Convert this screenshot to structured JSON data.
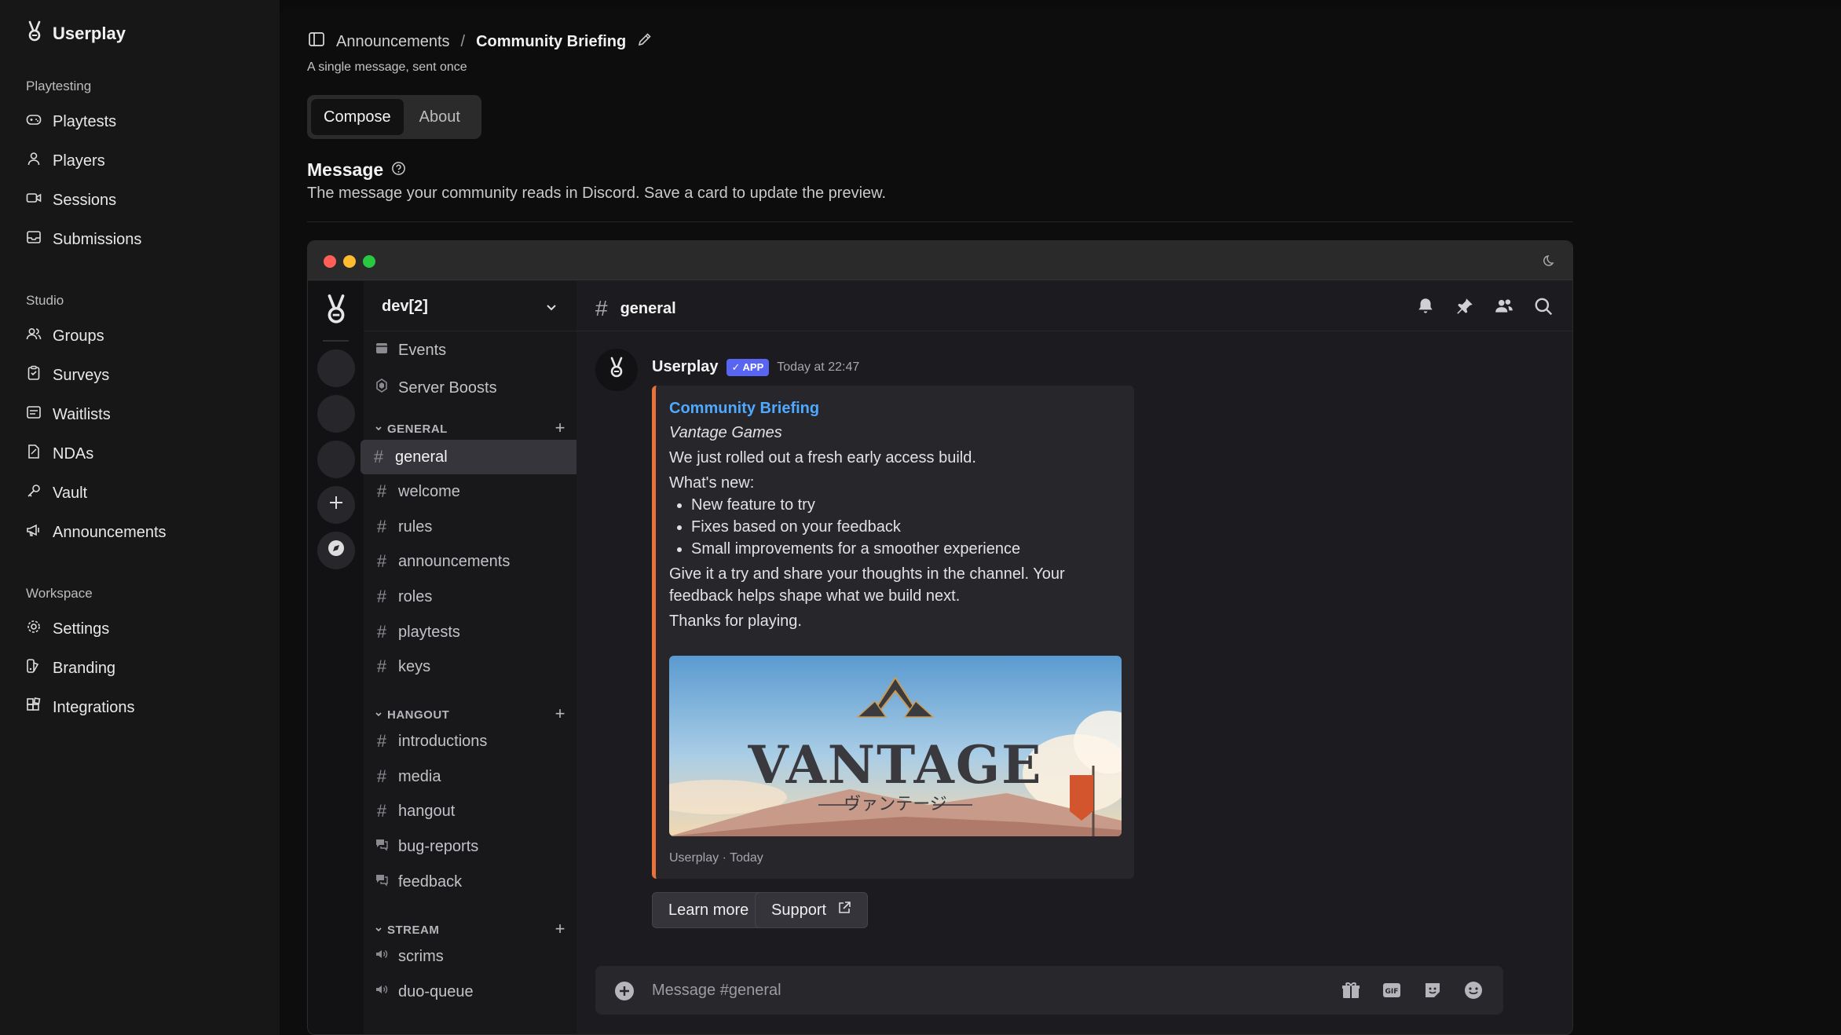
{
  "app": {
    "name": "Userplay"
  },
  "sidebar": {
    "sections": [
      {
        "title": "Playtesting",
        "items": [
          {
            "label": "Playtests",
            "icon": "gamepad-icon"
          },
          {
            "label": "Players",
            "icon": "user-icon"
          },
          {
            "label": "Sessions",
            "icon": "video-icon"
          },
          {
            "label": "Submissions",
            "icon": "inbox-icon"
          }
        ]
      },
      {
        "title": "Studio",
        "items": [
          {
            "label": "Groups",
            "icon": "users-icon"
          },
          {
            "label": "Surveys",
            "icon": "clipboard-icon"
          },
          {
            "label": "Waitlists",
            "icon": "list-icon"
          },
          {
            "label": "NDAs",
            "icon": "document-icon"
          },
          {
            "label": "Vault",
            "icon": "key-icon"
          },
          {
            "label": "Announcements",
            "icon": "megaphone-icon"
          }
        ]
      },
      {
        "title": "Workspace",
        "items": [
          {
            "label": "Settings",
            "icon": "gear-icon"
          },
          {
            "label": "Branding",
            "icon": "palette-icon"
          },
          {
            "label": "Integrations",
            "icon": "blocks-icon"
          }
        ]
      }
    ]
  },
  "header": {
    "breadcrumb_parent": "Announcements",
    "breadcrumb_separator": "/",
    "breadcrumb_current": "Community Briefing",
    "subtitle": "A single message, sent once"
  },
  "tabs": [
    {
      "label": "Compose",
      "active": true
    },
    {
      "label": "About",
      "active": false
    }
  ],
  "message_section": {
    "title": "Message",
    "description": "The message your community reads in Discord. Save a card to update the preview."
  },
  "discord": {
    "server_name": "dev[2]",
    "pre_channels": [
      {
        "label": "Events",
        "icon": "calendar-icon"
      },
      {
        "label": "Server Boosts",
        "icon": "boost-icon"
      }
    ],
    "categories": [
      {
        "name": "GENERAL",
        "channels": [
          {
            "label": "general",
            "type": "text",
            "active": true
          },
          {
            "label": "welcome",
            "type": "text"
          },
          {
            "label": "rules",
            "type": "text"
          },
          {
            "label": "announcements",
            "type": "text"
          },
          {
            "label": "roles",
            "type": "text"
          },
          {
            "label": "playtests",
            "type": "text"
          },
          {
            "label": "keys",
            "type": "text"
          }
        ]
      },
      {
        "name": "HANGOUT",
        "channels": [
          {
            "label": "introductions",
            "type": "text"
          },
          {
            "label": "media",
            "type": "text"
          },
          {
            "label": "hangout",
            "type": "text"
          },
          {
            "label": "bug-reports",
            "type": "forum"
          },
          {
            "label": "feedback",
            "type": "forum"
          }
        ]
      },
      {
        "name": "STREAM",
        "channels": [
          {
            "label": "scrims",
            "type": "voice"
          },
          {
            "label": "duo-queue",
            "type": "voice"
          }
        ]
      }
    ],
    "channel_title": "general",
    "message": {
      "author": "Userplay",
      "badge": "APP",
      "timestamp": "Today at 22:47",
      "embed": {
        "title": "Community Briefing",
        "author": "Vantage Games",
        "intro": "We just rolled out a fresh early access build.",
        "whats_new_label": "What's new:",
        "bullets": [
          "New feature to try",
          "Fixes based on your feedback",
          "Small improvements for a smoother experience"
        ],
        "body": "Give it a try and share your thoughts in the channel. Your feedback helps shape what we build next.",
        "closing": "Thanks for playing.",
        "image_title": "VANTAGE",
        "image_subtitle": "ヴァンテージ",
        "footer": "Userplay · Today",
        "accent_color": "#e8733a"
      },
      "buttons": [
        {
          "label": "Learn more",
          "icon": "external-link-icon"
        },
        {
          "label": "Support",
          "icon": "external-link-icon"
        }
      ]
    },
    "composer_placeholder": "Message #general"
  },
  "colors": {
    "app_background": "#0b0b0b",
    "sidebar": "#171717",
    "discord_blurple": "#5865f2",
    "embed_title": "#4ea9ff"
  }
}
